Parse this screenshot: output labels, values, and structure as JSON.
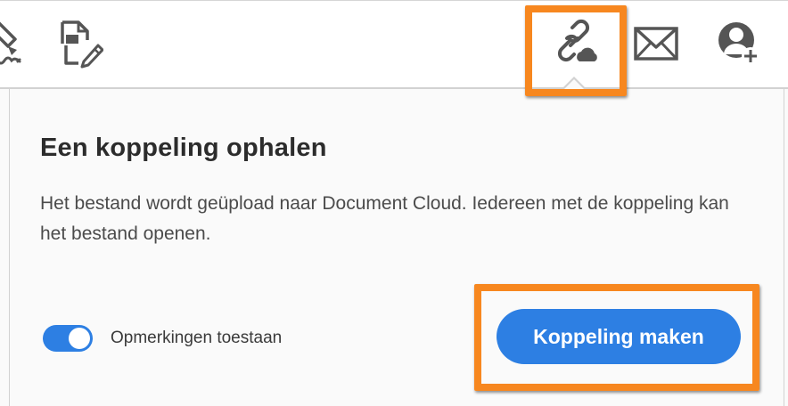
{
  "toolbar": {
    "tools": [
      {
        "icon": "fill-sign-icon"
      },
      {
        "icon": "export-pdf-icon"
      },
      {
        "icon": "link-cloud-icon",
        "highlighted": true
      },
      {
        "icon": "envelope-icon"
      },
      {
        "icon": "add-user-icon"
      }
    ]
  },
  "panel": {
    "title": "Een koppeling ophalen",
    "description": "Het bestand wordt geüpload naar Document Cloud. Iedereen met de koppeling kan het bestand openen.",
    "toggle": {
      "label": "Opmerkingen toestaan",
      "on": true
    },
    "primary_button_label": "Koppeling maken"
  },
  "colors": {
    "accent": "#2d7fe3",
    "highlight": "#f7871f",
    "icon": "#555555"
  }
}
